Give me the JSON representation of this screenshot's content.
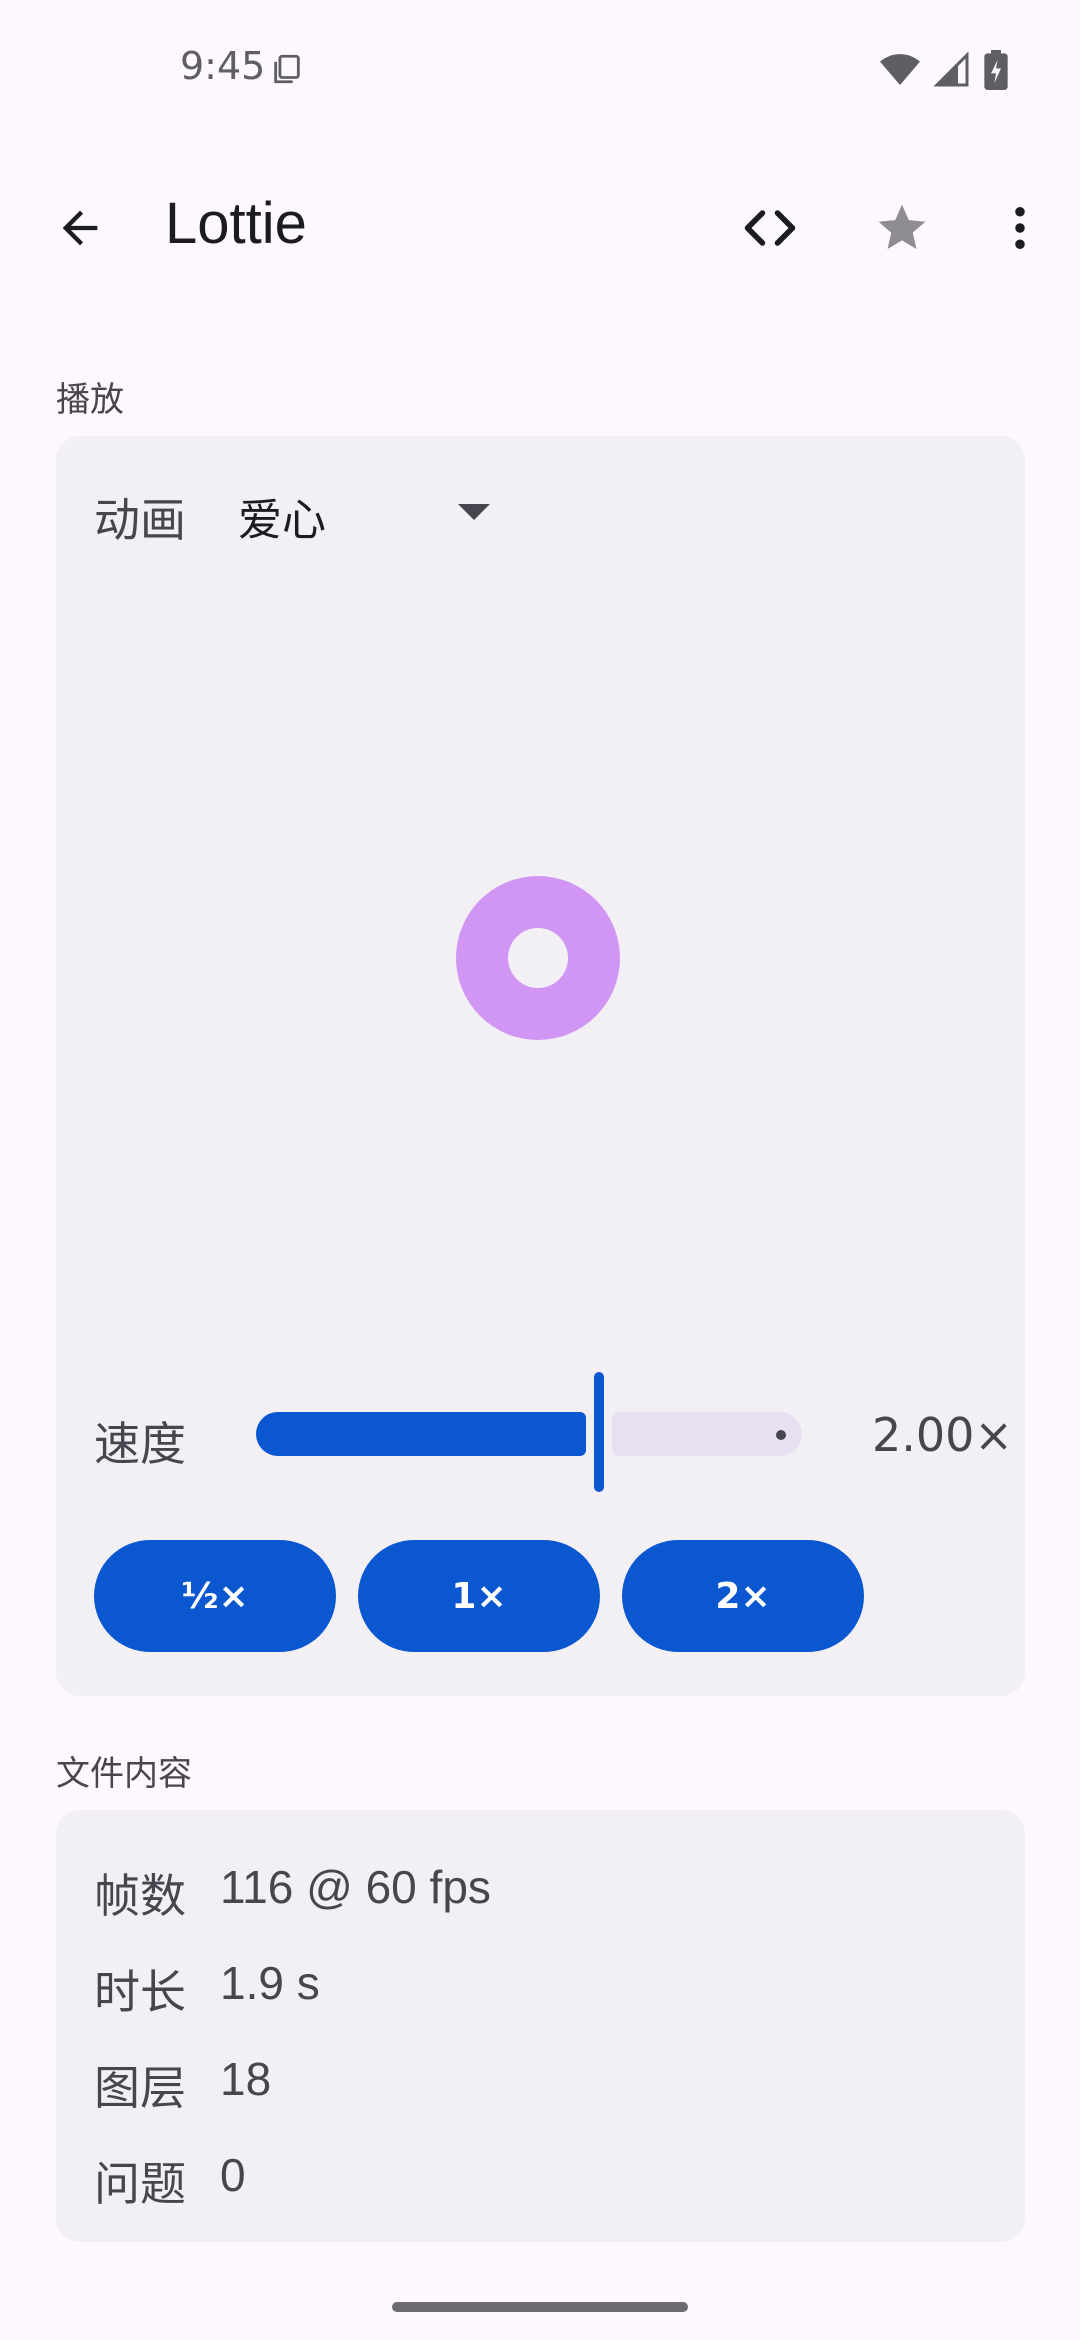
{
  "status_bar": {
    "time": "9:45",
    "icons": [
      "copy-icon",
      "wifi-icon",
      "signal-icon",
      "battery-charging-icon"
    ]
  },
  "app_bar": {
    "title": "Lottie",
    "back_icon": "arrow-back-icon",
    "code_icon": "code-icon",
    "star_icon": "star-icon",
    "more_icon": "more-vert-icon"
  },
  "playback": {
    "section_title": "播放",
    "animation_label": "动画",
    "animation_value": "爱心",
    "speed_label": "速度",
    "speed_value": "2.00×",
    "speed_level_fraction": 0.6,
    "presets": [
      "½×",
      "1×",
      "2×"
    ]
  },
  "file_content": {
    "section_title": "文件内容",
    "rows": [
      {
        "key": "帧数",
        "value": "116 @ 60 fps"
      },
      {
        "key": "时长",
        "value": "1.9 s"
      },
      {
        "key": "图层",
        "value": "18"
      },
      {
        "key": "问题",
        "value": "0"
      }
    ]
  },
  "colors": {
    "accent": "#0b57d0",
    "preview": "#d196f4",
    "card_bg": "#f2eff5",
    "page_bg": "#fdf8fd"
  }
}
